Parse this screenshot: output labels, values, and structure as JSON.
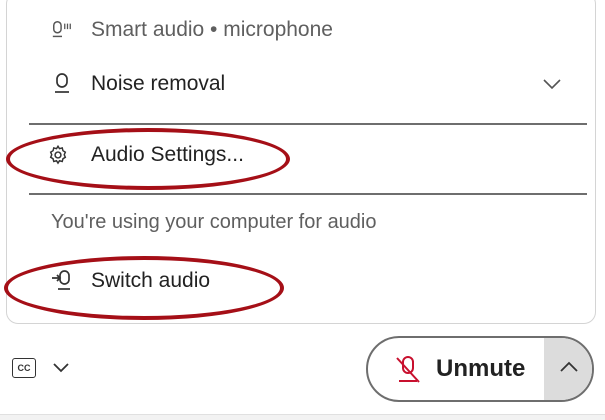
{
  "menu": {
    "smart_audio": "Smart audio • microphone",
    "noise_removal": "Noise removal",
    "audio_settings": "Audio Settings...",
    "info": "You're using your computer for audio",
    "switch_audio": "Switch audio"
  },
  "footer": {
    "cc_label": "CC",
    "unmute_label": "Unmute"
  },
  "colors": {
    "highlight": "#a50f17",
    "mute_red": "#c8102e"
  },
  "icons": [
    "microphone-boost-icon",
    "microphone-icon",
    "chevron-down-icon",
    "gear-icon",
    "switch-audio-icon",
    "closed-caption-icon",
    "muted-microphone-icon",
    "chevron-up-icon"
  ]
}
